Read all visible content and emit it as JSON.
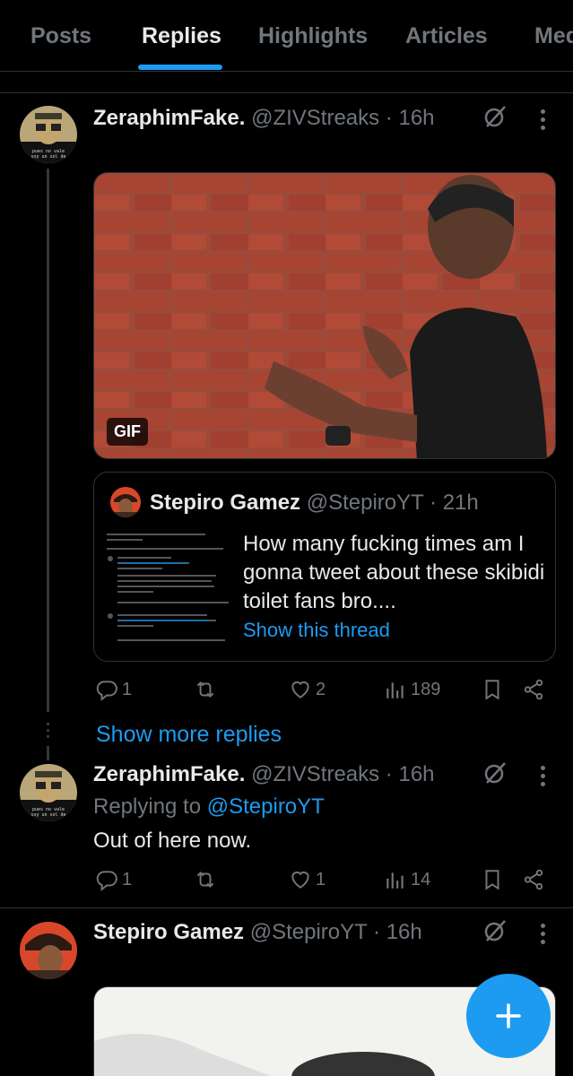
{
  "tabs": [
    {
      "label": "Posts"
    },
    {
      "label": "Replies"
    },
    {
      "label": "Highlights"
    },
    {
      "label": "Articles"
    },
    {
      "label": "Med"
    }
  ],
  "tweet1": {
    "name": "ZeraphimFake.",
    "handle": "@ZIVStreaks",
    "time": "16h",
    "gif_badge": "GIF",
    "quote": {
      "name": "Stepiro Gamez",
      "handle": "@StepiroYT",
      "time": "21h",
      "text": "How many fucking times am I gonna tweet about these skibidi toilet fans bro....",
      "link": "Show this thread"
    },
    "stats": {
      "replies": "1",
      "reposts": "",
      "likes": "2",
      "views": "189"
    }
  },
  "show_more": "Show more replies",
  "tweet2": {
    "name": "ZeraphimFake.",
    "handle": "@ZIVStreaks",
    "time": "16h",
    "replying_prefix": "Replying to",
    "replying_to": "@StepiroYT",
    "text": "Out of here now.",
    "stats": {
      "replies": "1",
      "reposts": "",
      "likes": "1",
      "views": "14"
    }
  },
  "tweet3": {
    "name": "Stepiro Gamez",
    "handle": "@StepiroYT",
    "time": "16h"
  },
  "colors": {
    "accent": "#1d9bf0",
    "muted": "#71767b",
    "text": "#e7e9ea",
    "bg": "#000000"
  },
  "icons": [
    "reply-icon",
    "repost-icon",
    "like-icon",
    "views-icon",
    "bookmark-icon",
    "share-icon",
    "grok-icon",
    "more-icon",
    "compose-icon"
  ]
}
